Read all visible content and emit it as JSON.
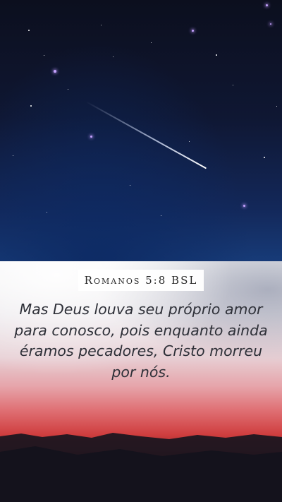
{
  "reference": "Romanos 5:8 BSL",
  "verse_text": "Mas Deus louva seu próprio amor para conosco, pois enquanto ainda éramos pecadores, Cristo morreu por nós.",
  "colors": {
    "sky_top": "#0c0f1e",
    "sky_bottom": "#173b78",
    "sunset_red": "#cf3e3f",
    "text": "#2e3038"
  }
}
